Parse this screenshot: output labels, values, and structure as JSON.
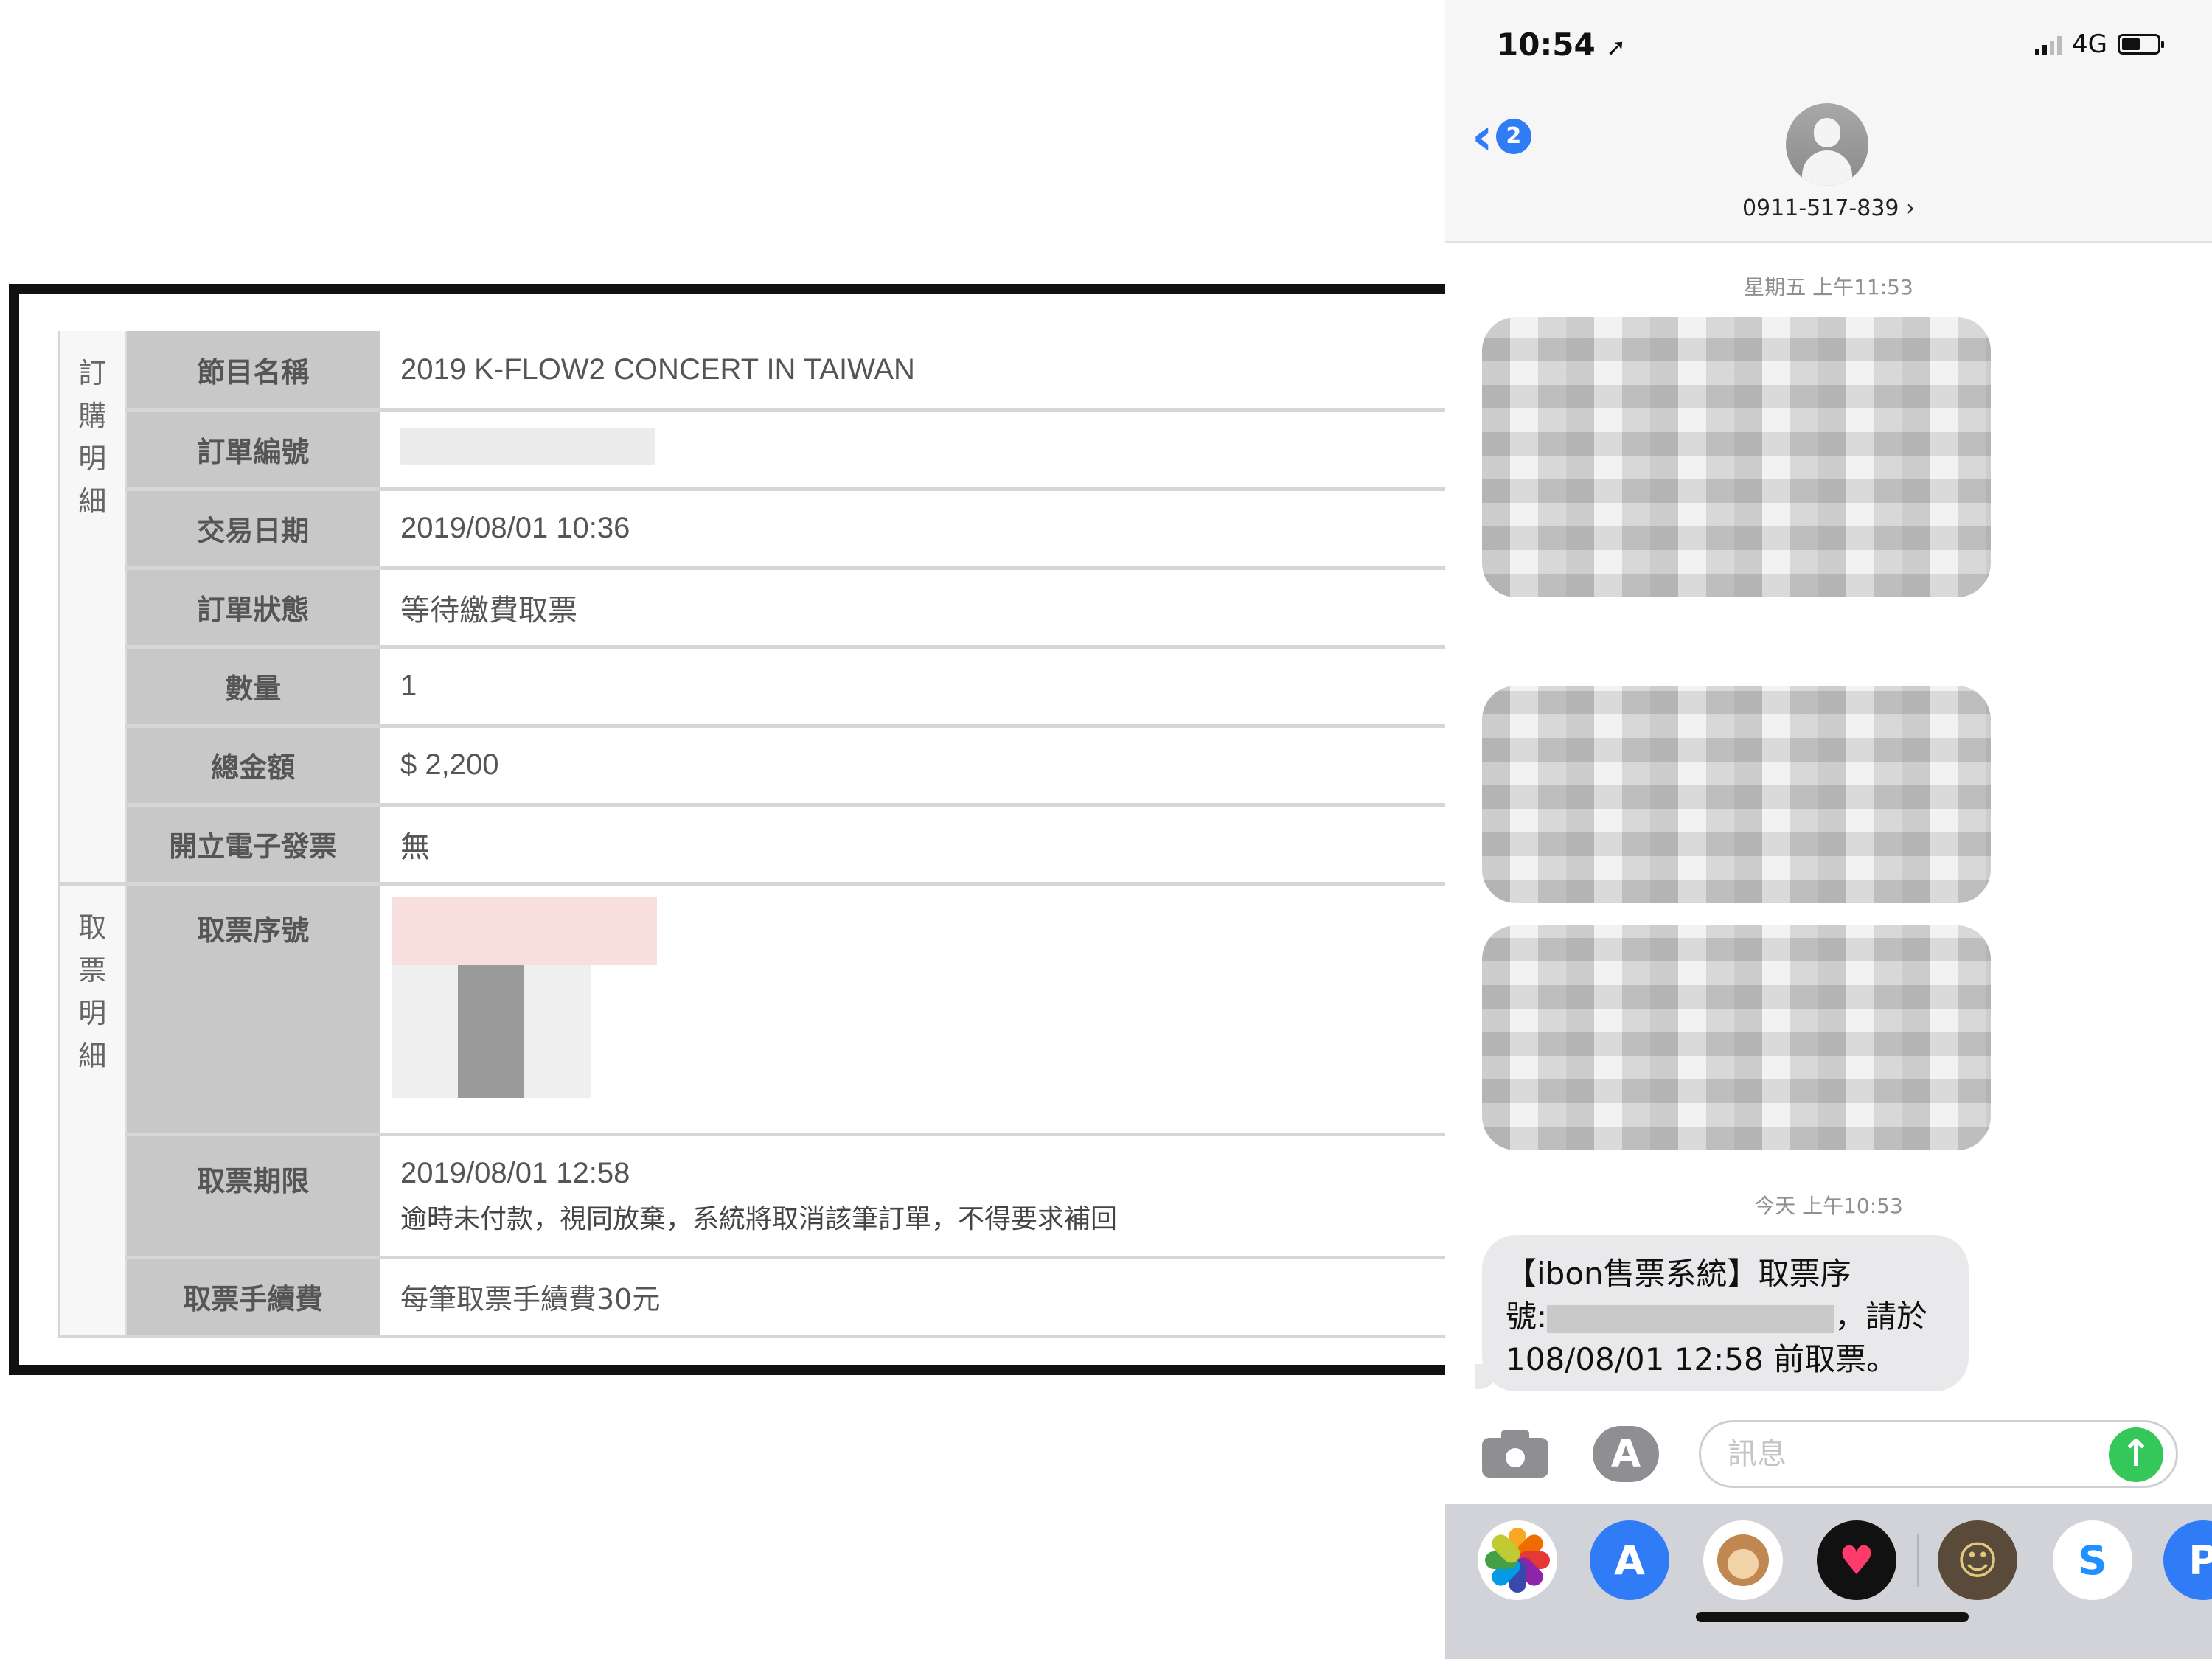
{
  "order": {
    "group_purchase": [
      "訂",
      "購",
      "明",
      "細"
    ],
    "group_pickup": [
      "取",
      "票",
      "明",
      "細"
    ],
    "rows": [
      {
        "label": "節目名稱",
        "value": "2019 K-FLOW2 CONCERT IN TAIWAN"
      },
      {
        "label": "訂單編號",
        "value": ""
      },
      {
        "label": "交易日期",
        "value": "2019/08/01 10:36"
      },
      {
        "label": "訂單狀態",
        "value": "等待繳費取票"
      },
      {
        "label": "數量",
        "value": "1"
      },
      {
        "label": "總金額",
        "value": "$ 2,200"
      },
      {
        "label": "開立電子發票",
        "value": "無"
      }
    ],
    "pickup": {
      "serial_label": "取票序號",
      "deadline_label": "取票期限",
      "deadline_value": "2019/08/01 12:58",
      "deadline_note": "逾時未付款，視同放棄，系統將取消該筆訂單，不得要求補回",
      "fee_label": "取票手續費",
      "fee_value": "每筆取票手續費30元"
    }
  },
  "phone": {
    "status": {
      "time": "10:54",
      "location_glyph": "➚",
      "network": "4G"
    },
    "header": {
      "back_count": "2",
      "contact": "0911-517-839 ›"
    },
    "timestamps": {
      "first": "星期五 上午11:53",
      "second": "今天 上午10:53"
    },
    "sms": {
      "line1": "【ibon售票系統】取票序",
      "line2_prefix": "號:",
      "line2_suffix": "，請於",
      "line3": "108/08/01 12:58 前取票。"
    },
    "input": {
      "placeholder": "訊息"
    },
    "icons": {
      "camera": "camera-icon",
      "appstore": "app-store-icon",
      "send": "send-arrow-icon",
      "drawer": [
        "photos-icon",
        "app-store-icon",
        "animoji-icon",
        "digital-touch-icon",
        "sticker-icon",
        "shazam-icon",
        "maps-icon"
      ]
    },
    "colors": {
      "accent": "#2f7cf6",
      "send": "#34c759",
      "bubble": "#e9e9eb"
    }
  }
}
